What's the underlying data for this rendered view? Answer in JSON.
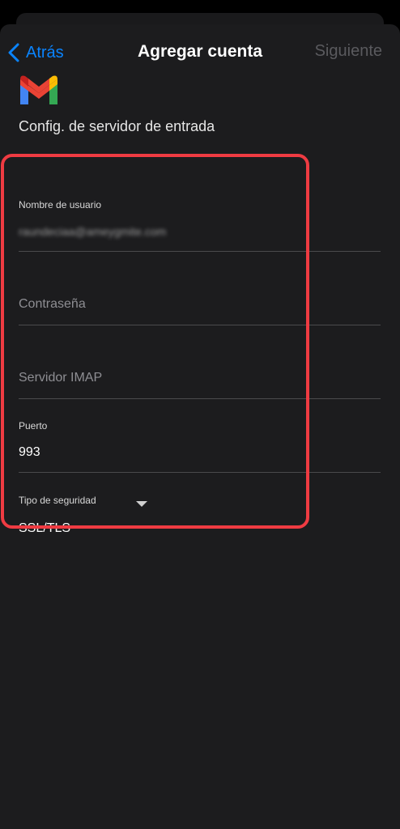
{
  "nav": {
    "back_label": "Atrás",
    "title": "Agregar cuenta",
    "next_label": "Siguiente"
  },
  "header": {
    "logo": "gmail-logo",
    "section_title": "Config. de servidor de entrada"
  },
  "form": {
    "username": {
      "label": "Nombre de usuario",
      "value": "raundeciaa@ameygmite.com"
    },
    "password": {
      "placeholder": "Contraseña"
    },
    "imap_server": {
      "placeholder": "Servidor IMAP"
    },
    "port": {
      "label": "Puerto",
      "value": "993"
    },
    "security": {
      "label": "Tipo de seguridad",
      "value": "SSL/TLS"
    }
  },
  "colors": {
    "accent": "#0a84ff",
    "highlight": "#ef3b42",
    "background": "#1c1c1e"
  }
}
